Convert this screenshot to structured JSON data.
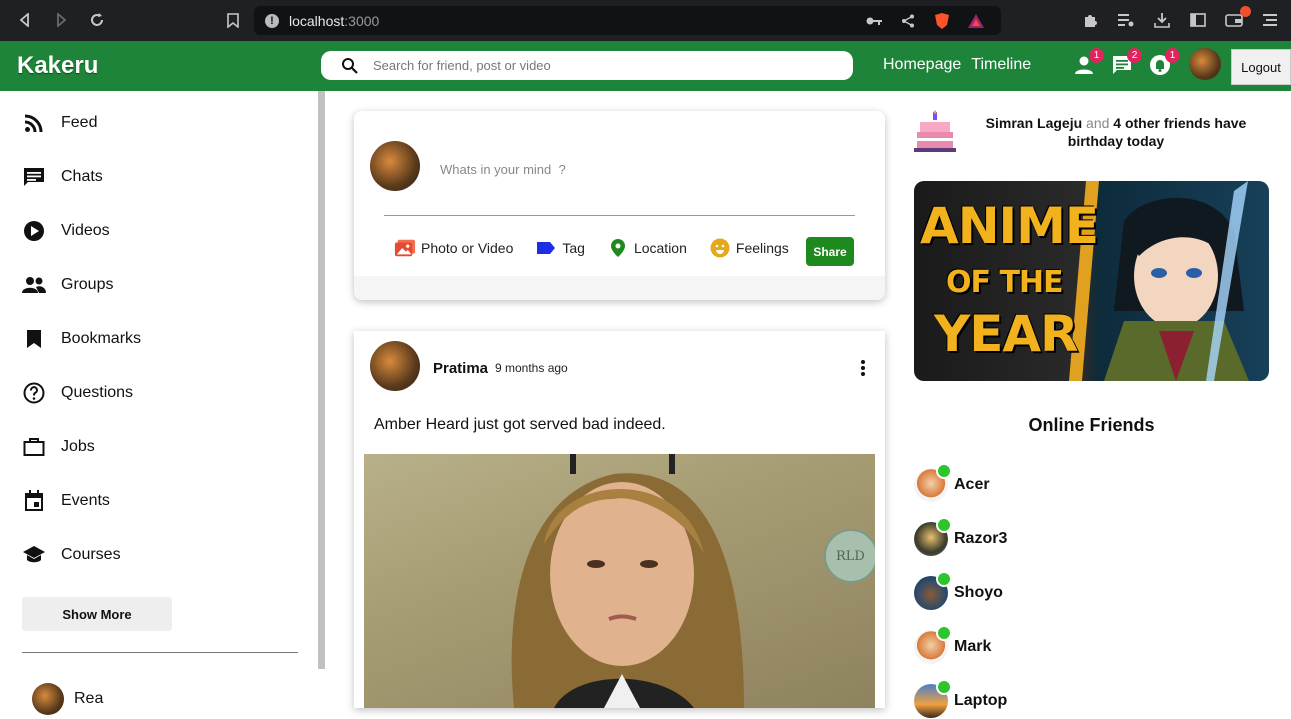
{
  "browser": {
    "url_host": "localhost",
    "url_port": ":3000"
  },
  "app": {
    "logo": "Kakeru",
    "search_placeholder": "Search for friend, post or video",
    "links": [
      "Homepage",
      "Timeline"
    ],
    "badges": {
      "friends": "1",
      "messages": "2",
      "notifications": "1"
    },
    "logout": "Logout"
  },
  "sidebar": {
    "items": [
      {
        "label": "Feed",
        "icon": "rss-icon"
      },
      {
        "label": "Chats",
        "icon": "chat-icon"
      },
      {
        "label": "Videos",
        "icon": "play-circle-icon"
      },
      {
        "label": "Groups",
        "icon": "group-icon"
      },
      {
        "label": "Bookmarks",
        "icon": "bookmark-icon"
      },
      {
        "label": "Questions",
        "icon": "help-circle-icon"
      },
      {
        "label": "Jobs",
        "icon": "briefcase-icon"
      },
      {
        "label": "Events",
        "icon": "calendar-icon"
      },
      {
        "label": "Courses",
        "icon": "school-icon"
      }
    ],
    "show_more": "Show More",
    "friend": "Rea"
  },
  "share": {
    "placeholder": "Whats in your mind  ?",
    "options": {
      "photo": "Photo or Video",
      "tag": "Tag",
      "location": "Location",
      "feelings": "Feelings"
    },
    "share_button": "Share"
  },
  "post": {
    "username": "Pratima",
    "time": "9 months ago",
    "text": "Amber Heard just got served bad indeed.",
    "watermark": "RLD"
  },
  "rightbar": {
    "birthday": {
      "name": "Simran Lageju",
      "and": "and",
      "others": "4 other friends have",
      "suffix": "birthday today"
    },
    "ad": {
      "line1": "ANIME",
      "line2": "OF THE",
      "line3": "YEAR"
    },
    "online_title": "Online Friends",
    "online": [
      "Acer",
      "Razor3",
      "Shoyo",
      "Mark",
      "Laptop"
    ]
  },
  "colors": {
    "brand_green": "#1e8439",
    "badge_red": "#e0245e",
    "online_green": "#2dc42d"
  }
}
